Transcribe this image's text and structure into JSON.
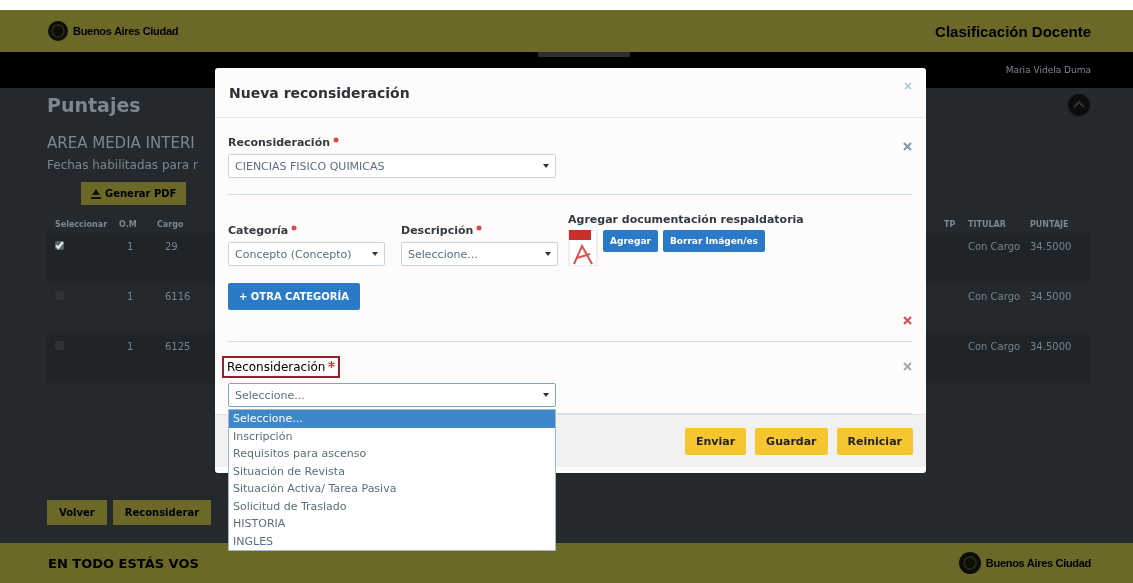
{
  "header": {
    "brand": "Buenos Aires Ciudad",
    "app_title": "Clasificación Docente"
  },
  "nav": {
    "user": "Maria Videla Duma"
  },
  "page": {
    "title": "Puntajes",
    "subtitle": "AREA MEDIA INTERI",
    "dates_note": "Fechas habilitadas para r",
    "pdf_button": "Generar PDF",
    "columns_left": [
      "Seleccionar",
      "O.M",
      "Cargo"
    ],
    "columns_right": [
      "TP",
      "TITULAR",
      "PUNTAJE"
    ],
    "rows": [
      {
        "checked": true,
        "om": "1",
        "cargo": "29",
        "titular": "Con Cargo",
        "puntaje": "34.5000"
      },
      {
        "checked": false,
        "om": "1",
        "cargo": "6116",
        "titular": "Con Cargo",
        "puntaje": "34.5000"
      },
      {
        "checked": false,
        "om": "1",
        "cargo": "6125",
        "titular": "Con Cargo",
        "puntaje": "34.5000"
      }
    ],
    "buttons": [
      "Volver",
      "Reconsiderar"
    ]
  },
  "modal": {
    "title": "Nueva reconsideración",
    "first": {
      "label": "Reconsideración",
      "required": true,
      "value": "CIENCIAS FISICO QUIMICAS"
    },
    "category": {
      "label": "Categoría",
      "required": true,
      "value": "Concepto (Concepto)"
    },
    "description": {
      "label": "Descripción",
      "required": true,
      "value": "Seleccione..."
    },
    "attachments": {
      "label": "Agregar documentación respaldatoria",
      "buttons": [
        "Agregar",
        "Borrar Imágen/es"
      ]
    },
    "add_category_button": "+ OTRA CATEGORÍA",
    "second": {
      "label": "Reconsideración",
      "required": true,
      "highlighted": true,
      "value": "Seleccione...",
      "expanded": true,
      "options": [
        {
          "label": "Seleccione...",
          "selected": true
        },
        {
          "label": "Inscripción",
          "selected": false
        },
        {
          "label": "Requisitos para ascenso",
          "selected": false
        },
        {
          "label": "Situación de Revista",
          "selected": false
        },
        {
          "label": "Situación Activa/ Tarea Pasiva",
          "selected": false
        },
        {
          "label": "Solicitud de Traslado",
          "selected": false
        },
        {
          "label": "HISTORIA",
          "selected": false
        },
        {
          "label": "INGLES",
          "selected": false
        }
      ]
    },
    "buttons": [
      "Enviar",
      "Guardar",
      "Reiniciar"
    ]
  },
  "footer": {
    "slogan": "EN TODO ESTÁS VOS",
    "brand": "Buenos Aires Ciudad"
  }
}
